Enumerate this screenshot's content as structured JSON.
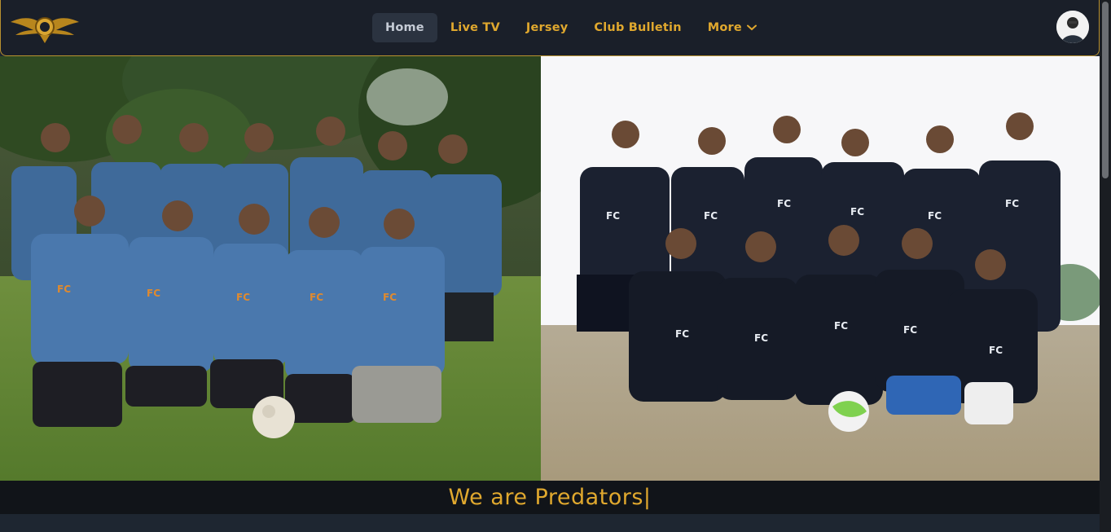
{
  "nav": {
    "items": [
      {
        "label": "Home",
        "active": true
      },
      {
        "label": "Live TV",
        "active": false
      },
      {
        "label": "Jersey",
        "active": false
      },
      {
        "label": "Club Bulletin",
        "active": false
      },
      {
        "label": "More",
        "active": false
      }
    ],
    "logo_icon": "eagle-crest-logo",
    "avatar_icon": "user-avatar"
  },
  "hero": {
    "left_photo": "team-photo-blue-jerseys",
    "right_photo": "team-photo-dark-jerseys"
  },
  "tagline": {
    "text": "We are Predators|"
  },
  "colors": {
    "accent_gold": "#e0a82e",
    "nav_bg": "#1a1f29",
    "tagline_bg": "#111419",
    "page_bg": "#1e2631"
  }
}
